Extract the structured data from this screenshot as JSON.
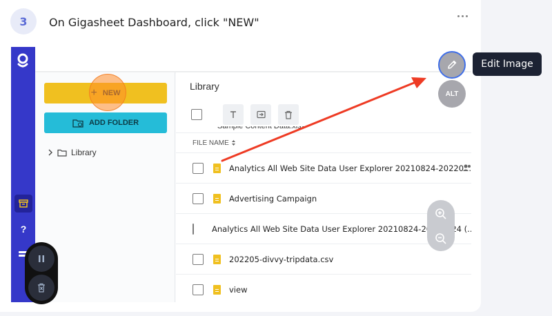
{
  "step": {
    "number": "3",
    "title": "On Gigasheet Dashboard, click \"NEW\""
  },
  "app": {
    "left_panel": {
      "new_label": "NEW",
      "add_folder_label": "ADD FOLDER",
      "tree_item": "Library"
    },
    "main": {
      "title": "Library",
      "scroll_ghost": "Sample Content Data.xlsx",
      "column_header": "FILE NAME",
      "files": [
        "Analytics All Web Site Data User Explorer 20210824-20220...",
        "Advertising Campaign",
        "Analytics All Web Site Data User Explorer 20210824-20220824 (...",
        "202205-divvy-tripdata.csv",
        "view"
      ]
    },
    "rail": {
      "help": "?"
    }
  },
  "editor": {
    "tooltip": "Edit Image",
    "alt_label": "ALT"
  },
  "colors": {
    "accent_blue": "#3538c9",
    "new_yellow": "#f0c020",
    "folder_cyan": "#25bcd8",
    "arrow_red": "#ee3b24"
  },
  "icons": [
    "more-icon",
    "gigasheet-logo",
    "archive-icon",
    "help-icon",
    "list-icon",
    "plus-icon",
    "folder-add-icon",
    "chevron-right-icon",
    "folder-icon",
    "text-icon",
    "move-icon",
    "trash-icon",
    "sort-icon",
    "file-icon",
    "shared-icon",
    "zoom-in-icon",
    "zoom-out-icon",
    "pause-icon",
    "delete-icon",
    "pencil-icon"
  ]
}
